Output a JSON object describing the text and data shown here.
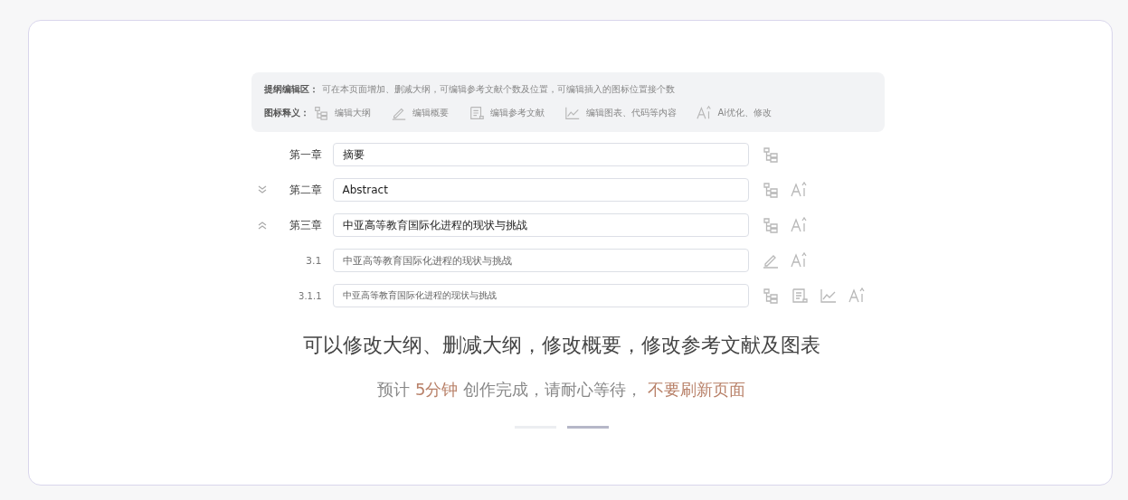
{
  "guide": {
    "title": "提纲编辑区：",
    "text": "可在本页面增加、删减大纲，可编辑参考文献个数及位置，可编辑插入的图标位置接个数",
    "legend_title": "图标释义：",
    "legend": [
      {
        "kind": "outline",
        "label": "编辑大纲"
      },
      {
        "kind": "edit",
        "label": "编辑概要"
      },
      {
        "kind": "refs",
        "label": "编辑参考文献"
      },
      {
        "kind": "chart",
        "label": "编辑图表、代码等内容"
      },
      {
        "kind": "ai",
        "label": "Ai优化、修改"
      }
    ]
  },
  "outline": [
    {
      "kind": "chapter",
      "label": "第一章",
      "value": "摘要",
      "tools": [
        {
          "kind": "outline"
        }
      ]
    },
    {
      "kind": "chapter",
      "label": "第二章",
      "value": "Abstract",
      "expanded": false,
      "tools": [
        {
          "kind": "outline"
        },
        {
          "kind": "ai"
        }
      ]
    },
    {
      "kind": "chapter",
      "label": "第三章",
      "value": "中亚高等教育国际化进程的现状与挑战",
      "expanded": true,
      "tools": [
        {
          "kind": "outline"
        },
        {
          "kind": "ai"
        }
      ]
    },
    {
      "kind": "section",
      "label": "3.1",
      "value": "中亚高等教育国际化进程的现状与挑战",
      "tools": [
        {
          "kind": "edit"
        },
        {
          "kind": "ai"
        }
      ]
    },
    {
      "kind": "subsection",
      "label": "3.1.1",
      "value": "中亚高等教育国际化进程的现状与挑战",
      "tools": [
        {
          "kind": "outline"
        },
        {
          "kind": "refs"
        },
        {
          "kind": "chart"
        },
        {
          "kind": "ai"
        }
      ]
    }
  ],
  "headline": "可以修改大纲、删减大纲，修改概要，修改参考文献及图表",
  "notice": [
    {
      "kind": "plain",
      "text": "预计 "
    },
    {
      "kind": "highlight",
      "text": "5分钟"
    },
    {
      "kind": "plain",
      "text": " 创作完成，请耐心等待， "
    },
    {
      "kind": "highlight",
      "text": "不要刷新页面"
    }
  ],
  "pager": [
    {
      "selected": false
    },
    {
      "selected": true
    }
  ]
}
